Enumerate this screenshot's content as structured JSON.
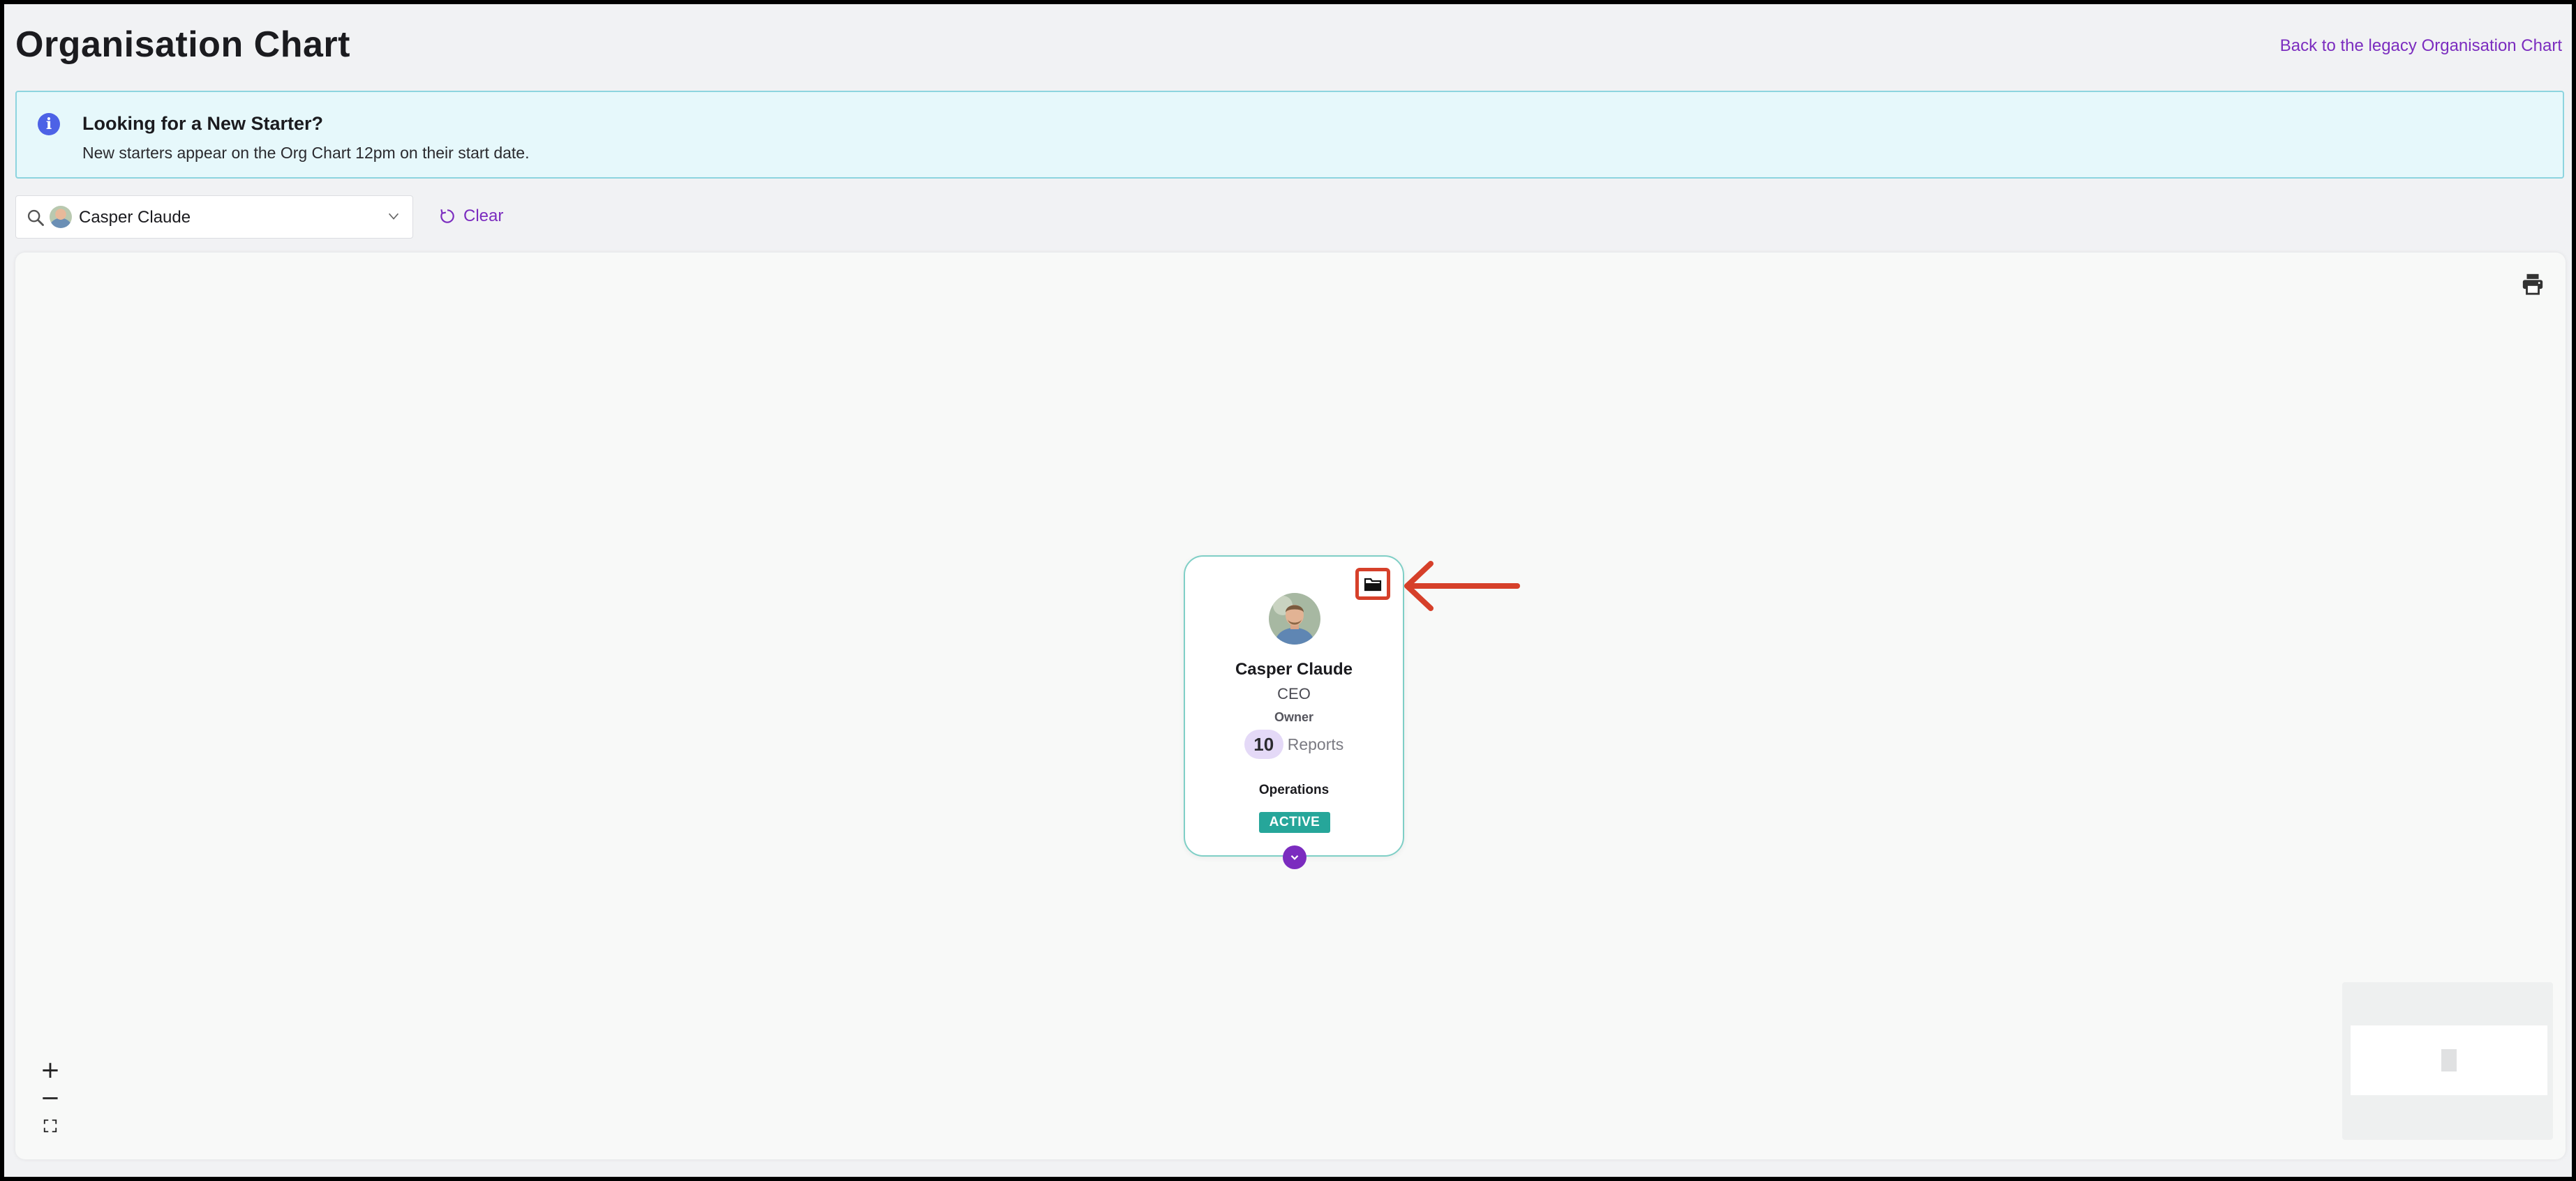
{
  "page": {
    "title": "Organisation Chart",
    "legacy_link": "Back to the legacy Organisation Chart"
  },
  "banner": {
    "title": "Looking for a New Starter?",
    "text": "New starters appear on the Org Chart 12pm on their start date."
  },
  "search": {
    "value": "Casper Claude",
    "clear_label": "Clear"
  },
  "card": {
    "name": "Casper Claude",
    "role": "CEO",
    "permission": "Owner",
    "reports_count": "10",
    "reports_label": "Reports",
    "department": "Operations",
    "status": "ACTIVE"
  },
  "zoom": {
    "in": "+",
    "out": "−"
  },
  "colors": {
    "accent": "#7b2cbf",
    "status_active": "#26a69a",
    "card_border": "#7fcfc6",
    "annotation": "#d6402a",
    "banner_bg": "#e6f8fb"
  },
  "icons": [
    "info-icon",
    "search-icon",
    "chevron-down-icon",
    "refresh-icon",
    "print-icon",
    "folder-icon",
    "chevron-down-icon",
    "fullscreen-icon"
  ]
}
